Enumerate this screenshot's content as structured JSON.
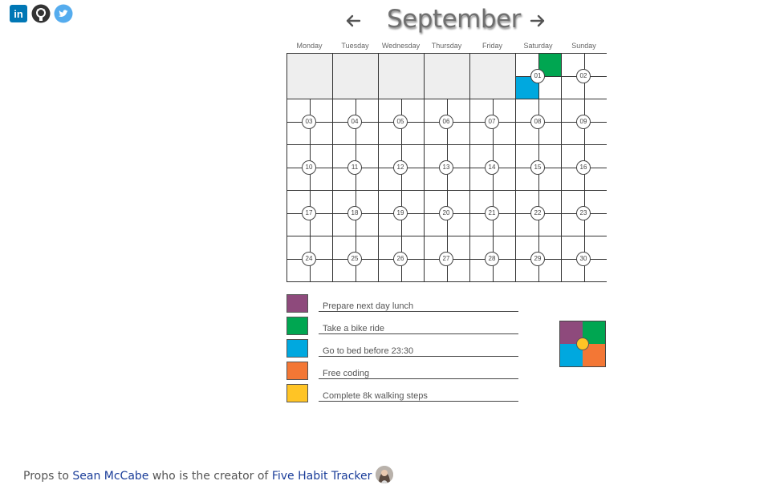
{
  "social": {
    "icons": [
      "linkedin-icon",
      "github-icon",
      "twitter-icon"
    ],
    "linkedin_label": "in"
  },
  "header": {
    "month": "September",
    "prev_icon": "arrow-left-icon",
    "next_icon": "arrow-right-icon"
  },
  "calendar": {
    "day_names": [
      "Monday",
      "Tuesday",
      "Wednesday",
      "Thursday",
      "Friday",
      "Saturday",
      "Sunday"
    ],
    "leading_empty_days": 5,
    "days": [
      "01",
      "02",
      "03",
      "04",
      "05",
      "06",
      "07",
      "08",
      "09",
      "10",
      "11",
      "12",
      "13",
      "14",
      "15",
      "16",
      "17",
      "18",
      "19",
      "20",
      "21",
      "22",
      "23",
      "24",
      "25",
      "26",
      "27",
      "28",
      "29",
      "30"
    ],
    "marked": [
      {
        "day": "01",
        "habits": [
          "bike",
          "bed"
        ]
      }
    ]
  },
  "habits": [
    {
      "id": "lunch",
      "label": "Prepare next day lunch",
      "color": "#8e4a7c"
    },
    {
      "id": "bike",
      "label": "Take a bike ride",
      "color": "#00a651"
    },
    {
      "id": "bed",
      "label": "Go to bed before 23:30",
      "color": "#00a8df"
    },
    {
      "id": "coding",
      "label": "Free coding",
      "color": "#f37735"
    },
    {
      "id": "steps",
      "label": "Complete 8k walking steps",
      "color": "#ffc425"
    }
  ],
  "footer": {
    "prefix": "Props to",
    "author_link": "Sean McCabe",
    "middle": "who is the creator of",
    "project_link": "Five Habit Tracker"
  },
  "colors": {
    "link": "#1a3d99",
    "empty_cell": "#eeeeee",
    "linkedin": "#0077b5",
    "github": "#333333",
    "twitter": "#55acee"
  }
}
